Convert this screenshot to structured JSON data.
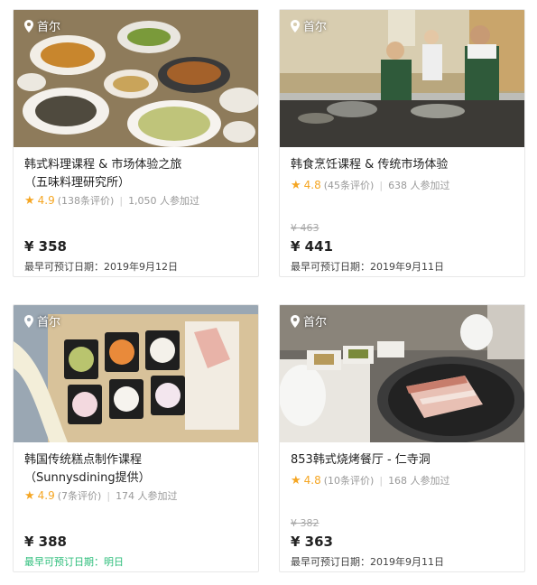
{
  "colors": {
    "star": "#f5a623",
    "price": "#222222",
    "available_tomorrow": "#2dbe7b"
  },
  "cards": [
    {
      "location": "首尔",
      "title_line1": "韩式料理课程 & 市场体验之旅",
      "title_line2": "（五味料理研究所）",
      "rating": "4.9",
      "reviews": "(138条评价)",
      "participants": "1,050 人参加过",
      "original_price": "",
      "price": "¥ 358",
      "earliest_date": "最早可预订日期：2019年9月12日"
    },
    {
      "location": "首尔",
      "title_line1": "韩食烹饪课程 & 传统市场体验",
      "title_line2": "",
      "rating": "4.8",
      "reviews": "(45条评价)",
      "participants": "638 人参加过",
      "original_price": "¥ 463",
      "price": "¥ 441",
      "earliest_date": "最早可预订日期：2019年9月11日"
    },
    {
      "location": "首尔",
      "title_line1": "韩国传统糕点制作课程",
      "title_line2": "（Sunnysdining提供）",
      "rating": "4.9",
      "reviews": "(7条评价)",
      "participants": "174 人参加过",
      "original_price": "",
      "price": "¥ 388",
      "earliest_date": "最早可预订日期：明日"
    },
    {
      "location": "首尔",
      "title_line1": "853韩式烧烤餐厅 - 仁寺洞",
      "title_line2": "",
      "rating": "4.8",
      "reviews": "(10条评价)",
      "participants": "168 人参加过",
      "original_price": "¥ 382",
      "price": "¥ 363",
      "earliest_date": "最早可预订日期：2019年9月11日"
    }
  ]
}
